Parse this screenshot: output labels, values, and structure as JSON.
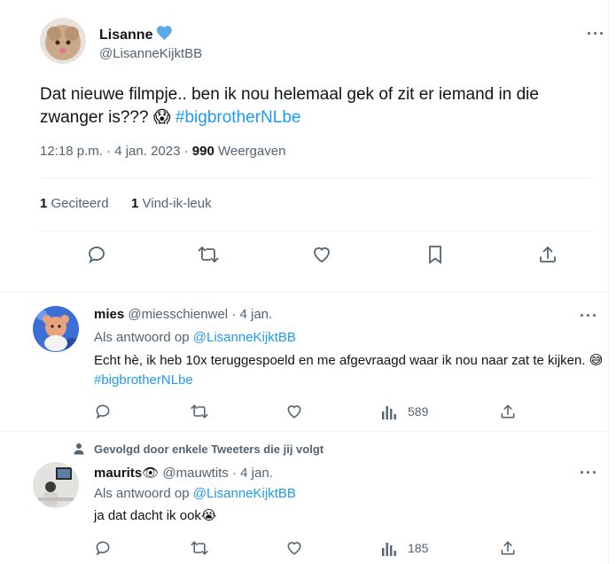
{
  "main": {
    "name": "Lisanne",
    "handle": "@LisanneKijktBB",
    "text": "Dat nieuwe filmpje.. ben ik nou helemaal gek of zit er iemand in die zwanger is???",
    "emoji": "😱",
    "hashtag": "#bigbrotherNLbe",
    "time": "12:18 p.m. · 4 jan. 2023 ·",
    "views_count": "990",
    "views_label": "Weergaven",
    "quotes_count": "1",
    "quotes_label": "Geciteerd",
    "likes_count": "1",
    "likes_label": "Vind-ik-leuk",
    "verified_color": "#5aa9e6"
  },
  "replies": [
    {
      "name": "mies",
      "handle": "@miesschienwel",
      "date": "· 4 jan.",
      "reply_to_prefix": "Als antwoord op",
      "reply_to_handle": "@LisanneKijktBB",
      "text": "Echt hè, ik heb 10x teruggespoeld en me afgevraagd waar ik nou naar zat te kijken.",
      "emoji": "😅",
      "hashtag": "#bigbrotherNLbe",
      "views": "589"
    },
    {
      "social_context": "Gevolgd door enkele Tweeters die jij volgt",
      "name": "maurits",
      "name_emoji": "👁",
      "handle": "@mauwtits",
      "date": "· 4 jan.",
      "reply_to_prefix": "Als antwoord op",
      "reply_to_handle": "@LisanneKijktBB",
      "text": "ja dat dacht ik ook",
      "emoji": "😭",
      "views": "185"
    }
  ],
  "colors": {
    "accent": "#1d9bf0",
    "muted": "#536471",
    "divider": "#eff3f4"
  }
}
